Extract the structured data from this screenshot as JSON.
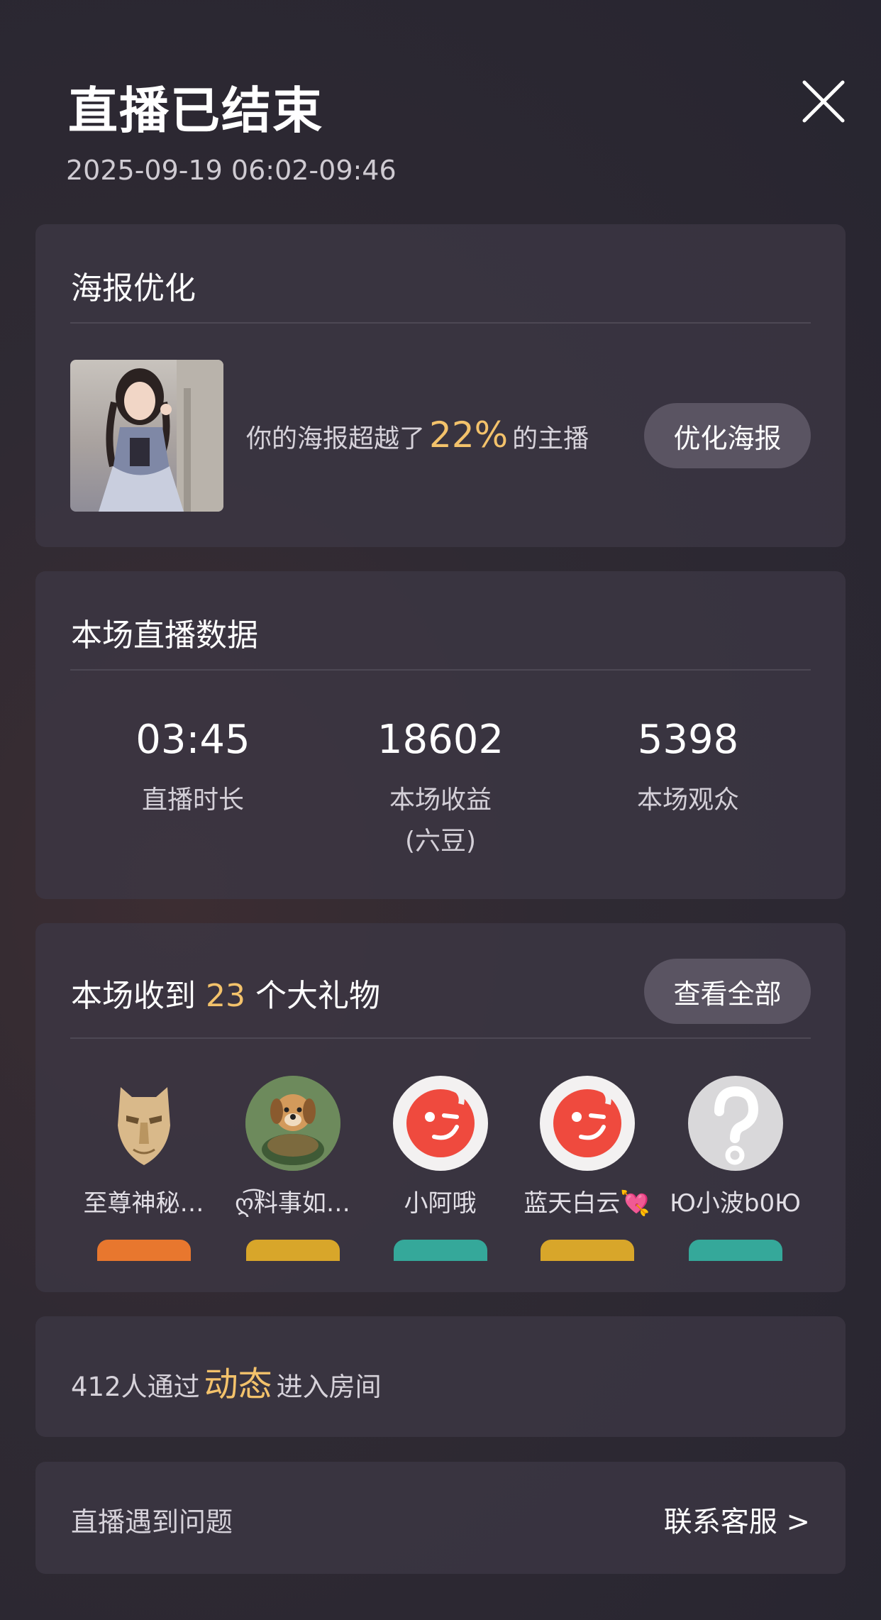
{
  "header": {
    "title": "直播已结束",
    "time_range": "2025-09-19 06:02-09:46"
  },
  "poster": {
    "title": "海报优化",
    "text_prefix": "你的海报超越了",
    "percent": "22%",
    "text_suffix": "的主播",
    "button_label": "优化海报"
  },
  "stats": {
    "title": "本场直播数据",
    "items": [
      {
        "value": "03:45",
        "label": "直播时长"
      },
      {
        "value": "18602",
        "label": "本场收益",
        "sublabel": "(六豆)"
      },
      {
        "value": "5398",
        "label": "本场观众"
      }
    ]
  },
  "gifts": {
    "title_prefix": "本场收到",
    "count": "23",
    "title_suffix": "个大礼物",
    "button_label": "查看全部",
    "gifters": [
      {
        "name": "至尊神秘…",
        "avatar": "mask-icon",
        "badge_color": "#e8772e"
      },
      {
        "name": "ღ͡料事如…",
        "avatar": "dog-icon",
        "badge_color": "#d8a62a"
      },
      {
        "name": "小阿哦",
        "avatar": "wink-face-icon",
        "badge_color": "#35a89a"
      },
      {
        "name": "蓝天白云💘",
        "avatar": "wink-face-icon",
        "badge_color": "#d8a62a"
      },
      {
        "name": "Ю小波b0Ю",
        "avatar": "question-icon",
        "badge_color": "#35a89a"
      }
    ]
  },
  "moments": {
    "prefix": "412人通过",
    "highlight": "动态",
    "suffix": "进入房间"
  },
  "help": {
    "text": "直播遇到问题",
    "link": "联系客服 >"
  },
  "colors": {
    "accent": "#f3c26b",
    "card_bg": "#3c3744",
    "button_bg": "#5a5462"
  }
}
